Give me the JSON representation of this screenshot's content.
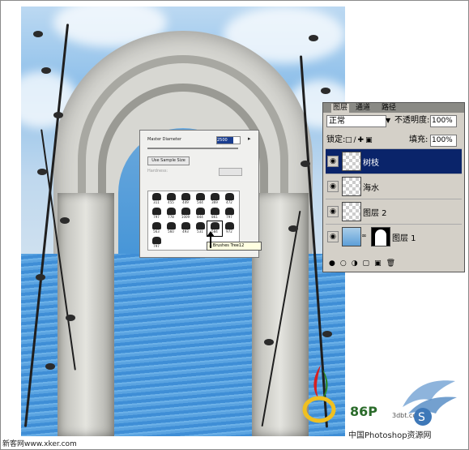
{
  "brush_panel": {
    "master_diameter_label": "Master Diameter",
    "master_diameter_value": "2500 px",
    "use_sample_size_label": "Use Sample Size",
    "hardness_label": "Hardness:",
    "brushes": [
      {
        "row": 0,
        "col": 0,
        "size": "311"
      },
      {
        "row": 0,
        "col": 1,
        "size": "455"
      },
      {
        "row": 0,
        "col": 2,
        "size": "449"
      },
      {
        "row": 0,
        "col": 3,
        "size": "544"
      },
      {
        "row": 0,
        "col": 4,
        "size": "369"
      },
      {
        "row": 0,
        "col": 5,
        "size": "472"
      },
      {
        "row": 1,
        "col": 0,
        "size": "797"
      },
      {
        "row": 1,
        "col": 1,
        "size": "778"
      },
      {
        "row": 1,
        "col": 2,
        "size": "1009"
      },
      {
        "row": 1,
        "col": 3,
        "size": "844"
      },
      {
        "row": 1,
        "col": 4,
        "size": "861"
      },
      {
        "row": 1,
        "col": 5,
        "size": "797"
      },
      {
        "row": 2,
        "col": 0,
        "size": "563"
      },
      {
        "row": 2,
        "col": 1,
        "size": "560"
      },
      {
        "row": 2,
        "col": 2,
        "size": "493"
      },
      {
        "row": 2,
        "col": 3,
        "size": "531"
      },
      {
        "row": 2,
        "col": 4,
        "size": "584"
      },
      {
        "row": 2,
        "col": 5,
        "size": "972"
      },
      {
        "row": 3,
        "col": 0,
        "size": "797"
      }
    ],
    "tooltip": "...Brushes Tree12"
  },
  "layers_panel": {
    "tabs": [
      "图层",
      "通道",
      "路径"
    ],
    "blend_mode": "正常",
    "opacity_label": "不透明度:",
    "opacity_value": "100%",
    "lock_label": "锁定:",
    "fill_label": "填充:",
    "fill_value": "100%",
    "layers": [
      {
        "name": "树枝",
        "selected": true
      },
      {
        "name": "海水",
        "selected": false
      },
      {
        "name": "图层 2",
        "selected": false
      },
      {
        "name": "图层 1",
        "selected": false
      }
    ]
  },
  "watermarks": {
    "left": "新客网www.xker.com",
    "brand_86": "86P",
    "brand_cn": "中国Photoshop资源网",
    "domain_3dbt": "3dbt.com"
  }
}
